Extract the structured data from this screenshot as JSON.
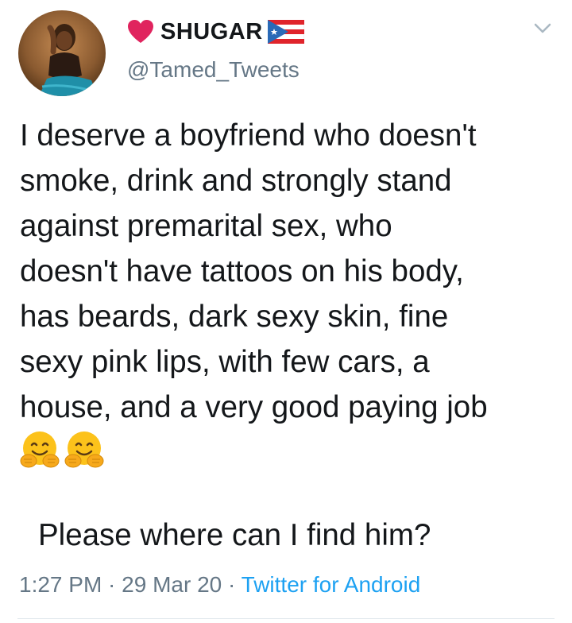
{
  "user": {
    "display_name": "SHUGAR",
    "handle": "@Tamed_Tweets",
    "heart_icon": "red-heart-emoji",
    "flag_icon": "puerto-rico-flag-emoji"
  },
  "tweet": {
    "text": "I deserve a boyfriend who doesn't\nsmoke, drink and strongly stand\nagainst premarital sex, who\ndoesn't have tattoos on his body,\nhas beards, dark sexy skin, fine\nsexy pink lips, with few cars, a\nhouse, and a very good paying job",
    "emojis": [
      "hugging-face-emoji",
      "hugging-face-emoji"
    ],
    "followup": "Please where can I find him?"
  },
  "meta": {
    "time": "1:27 PM",
    "sep1": " · ",
    "date": "29 Mar 20",
    "sep2": " · ",
    "source": "Twitter for Android"
  },
  "colors": {
    "text": "#14171a",
    "secondary": "#657786",
    "link": "#1da1f2",
    "heart": "#e0245e"
  }
}
